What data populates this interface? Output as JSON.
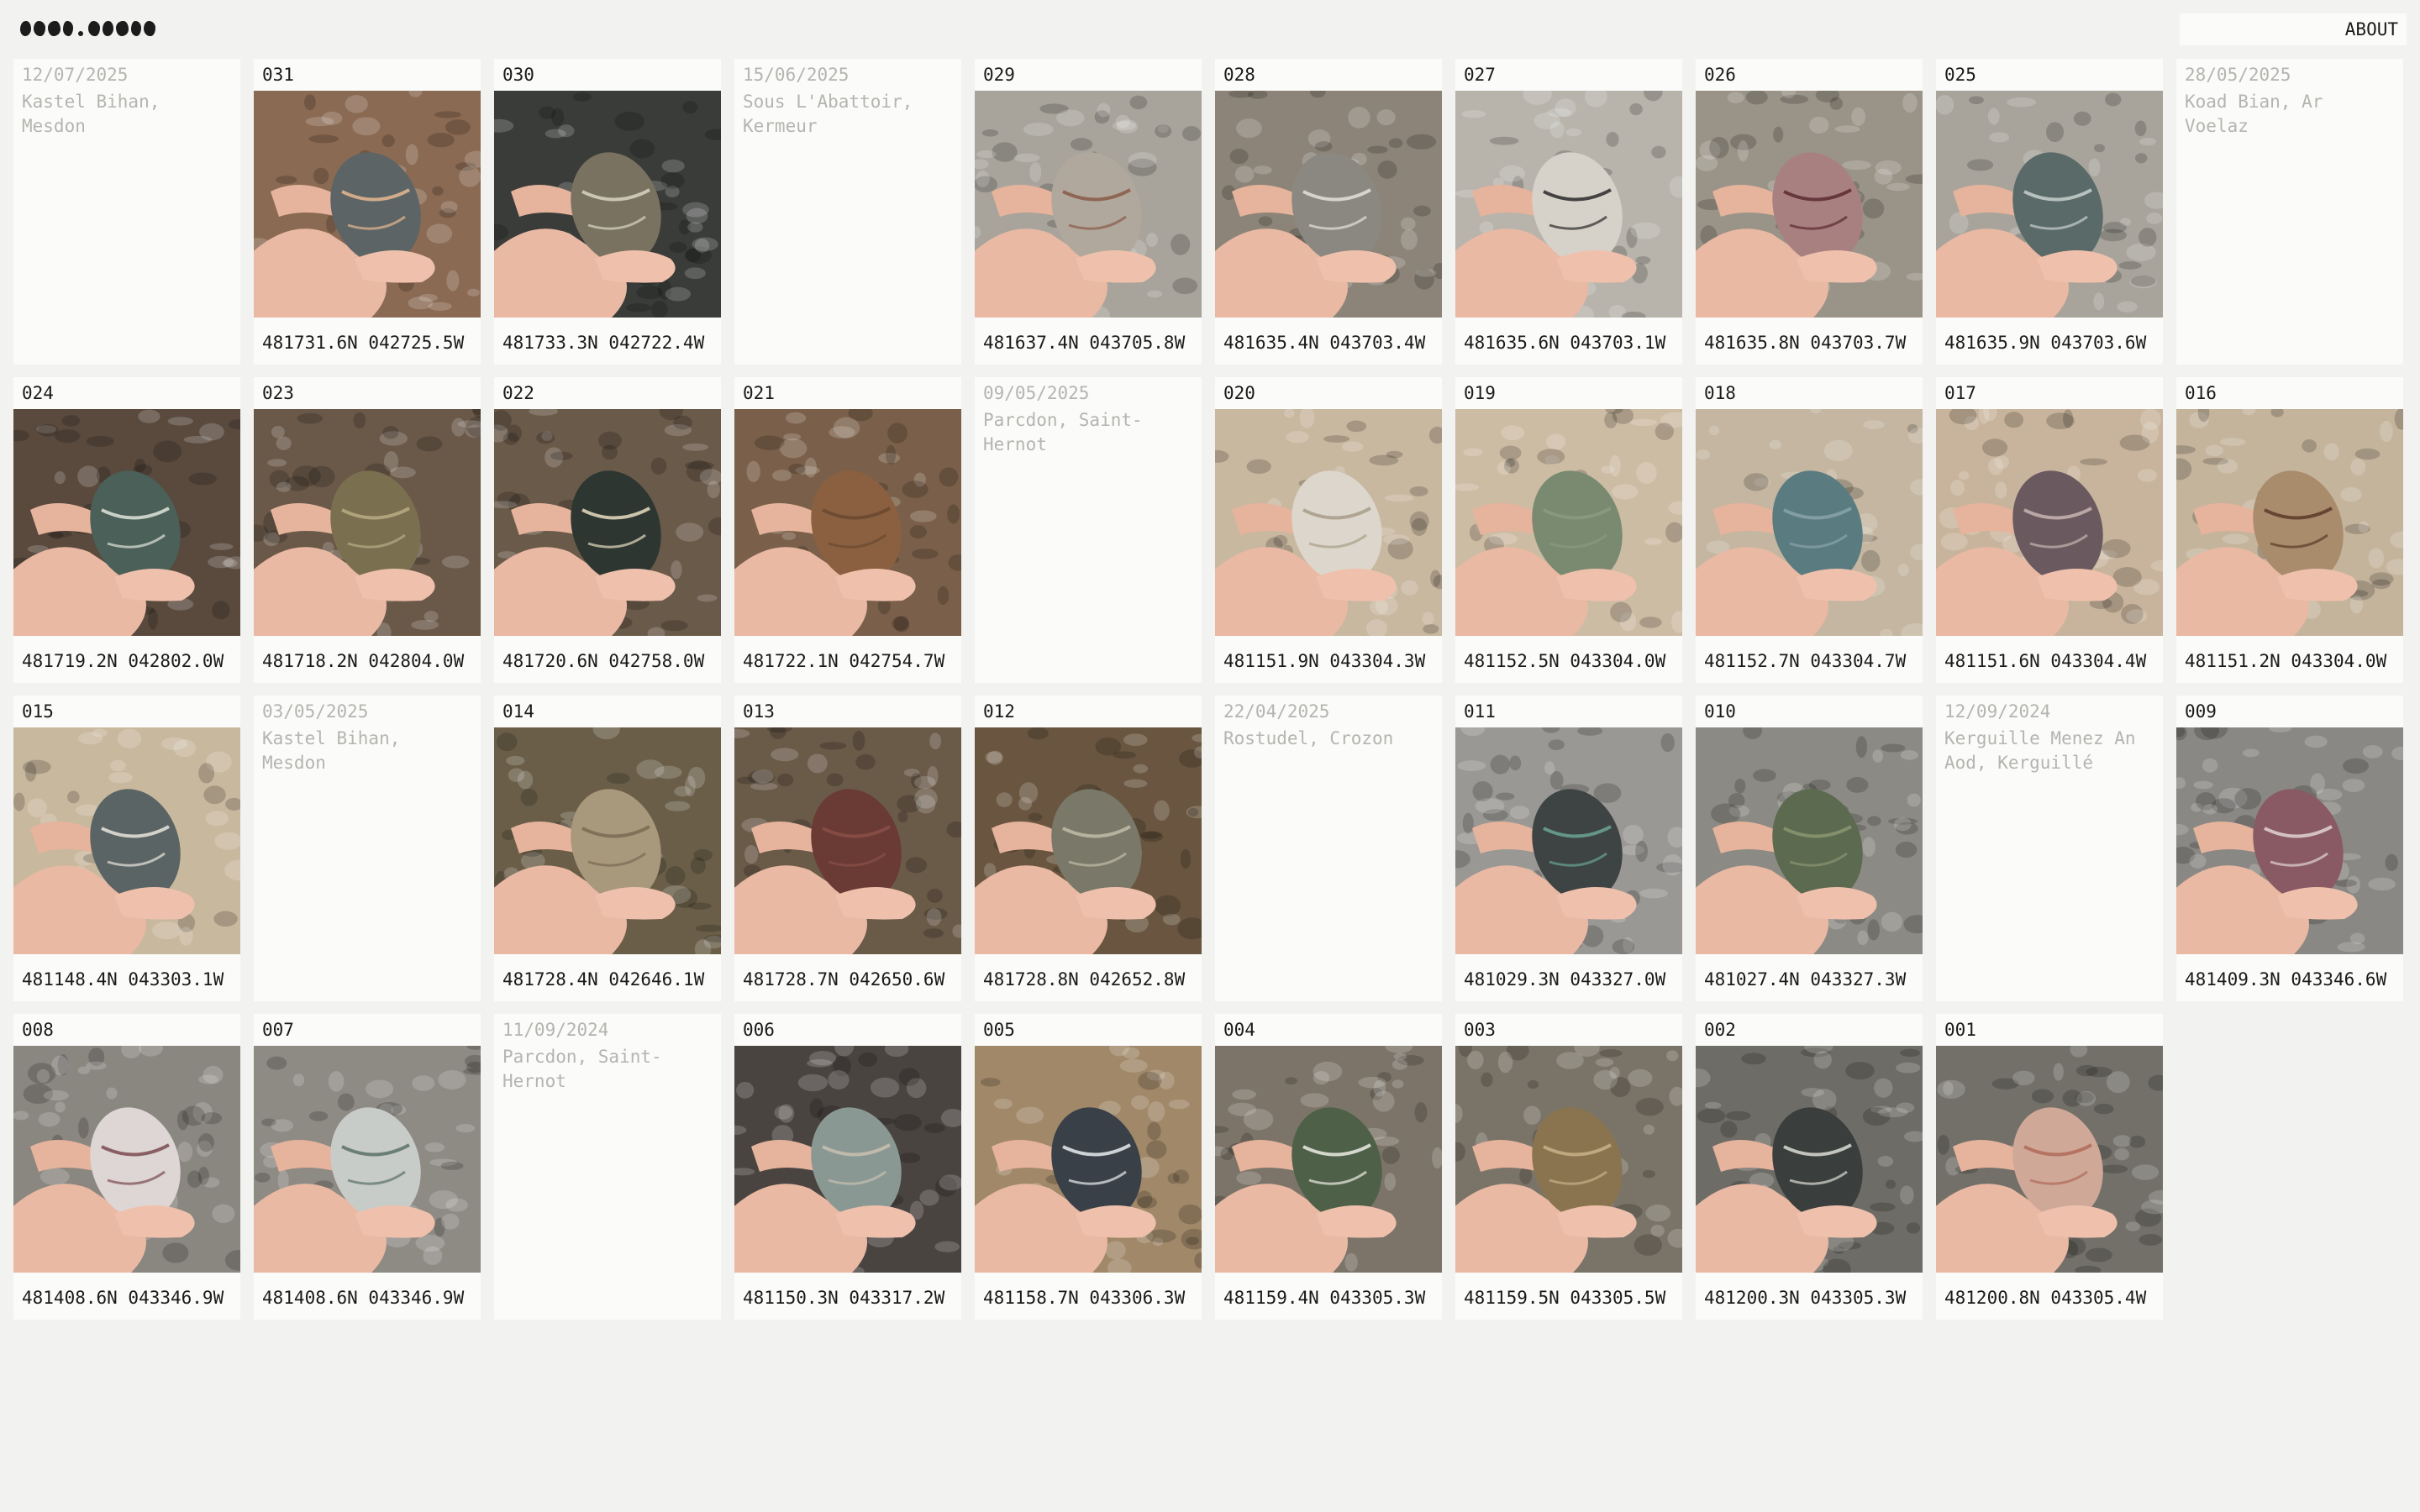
{
  "header": {
    "about_label": "ABOUT"
  },
  "cards": [
    {
      "kind": "date",
      "date": "12/07/2025",
      "place": "Kastel Bihan, Mesdon"
    },
    {
      "kind": "stone",
      "num": "031",
      "coord": "481731.6N 042725.5W",
      "bg": "#8a6a52",
      "stone": "#5c6466",
      "accent": "#e6b890"
    },
    {
      "kind": "stone",
      "num": "030",
      "coord": "481733.3N 042722.4W",
      "bg": "#3a3c3a",
      "stone": "#7a7260",
      "accent": "#d8d4c4"
    },
    {
      "kind": "date",
      "date": "15/06/2025",
      "place": "Sous L'Abattoir, Kermeur"
    },
    {
      "kind": "stone",
      "num": "029",
      "coord": "481637.4N 043705.8W",
      "bg": "#a8a49c",
      "stone": "#b0a89c",
      "accent": "#8a5a48"
    },
    {
      "kind": "stone",
      "num": "028",
      "coord": "481635.4N 043703.4W",
      "bg": "#8c8478",
      "stone": "#8a8880",
      "accent": "#e4e2dc"
    },
    {
      "kind": "stone",
      "num": "027",
      "coord": "481635.6N 043703.1W",
      "bg": "#b8b4ac",
      "stone": "#d6d2ca",
      "accent": "#2a2a2a"
    },
    {
      "kind": "stone",
      "num": "026",
      "coord": "481635.8N 043703.7W",
      "bg": "#9a9488",
      "stone": "#a88080",
      "accent": "#5a2a30"
    },
    {
      "kind": "stone",
      "num": "025",
      "coord": "481635.9N 043703.6W",
      "bg": "#a8a49c",
      "stone": "#5a6a68",
      "accent": "#c8d0cc"
    },
    {
      "kind": "date",
      "date": "28/05/2025",
      "place": "Koad Bian, Ar Voelaz"
    },
    {
      "kind": "stone",
      "num": "024",
      "coord": "481719.2N 042802.0W",
      "bg": "#5a4a3e",
      "stone": "#4a6058",
      "accent": "#e0e4dc"
    },
    {
      "kind": "stone",
      "num": "023",
      "coord": "481718.2N 042804.0W",
      "bg": "#6a5848",
      "stone": "#7a7050",
      "accent": "#b8ac84"
    },
    {
      "kind": "stone",
      "num": "022",
      "coord": "481720.6N 042758.0W",
      "bg": "#6a5a4a",
      "stone": "#2e3632",
      "accent": "#e6dcc0"
    },
    {
      "kind": "stone",
      "num": "021",
      "coord": "481722.1N 042754.7W",
      "bg": "#7a604a",
      "stone": "#8a6040",
      "accent": "#6a4830"
    },
    {
      "kind": "date",
      "date": "09/05/2025",
      "place": "Parcdon, Saint-Hernot"
    },
    {
      "kind": "stone",
      "num": "020",
      "coord": "481151.9N 043304.3W",
      "bg": "#c8b8a0",
      "stone": "#dcd6cc",
      "accent": "#a89c88"
    },
    {
      "kind": "stone",
      "num": "019",
      "coord": "481152.5N 043304.0W",
      "bg": "#cdbca4",
      "stone": "#7a8a70",
      "accent": "#8a9a80"
    },
    {
      "kind": "stone",
      "num": "018",
      "coord": "481152.7N 043304.7W",
      "bg": "#c4b6a0",
      "stone": "#5a7c80",
      "accent": "#8aa4a8"
    },
    {
      "kind": "stone",
      "num": "017",
      "coord": "481151.6N 043304.4W",
      "bg": "#c8b49c",
      "stone": "#6a5a60",
      "accent": "#c8b4b0"
    },
    {
      "kind": "stone",
      "num": "016",
      "coord": "481151.2N 043304.0W",
      "bg": "#c4b49c",
      "stone": "#a88c6c",
      "accent": "#5a3a28"
    },
    {
      "kind": "stone",
      "num": "015",
      "coord": "481148.4N 043303.1W",
      "bg": "#c8b89e",
      "stone": "#5a6464",
      "accent": "#e8e4dc"
    },
    {
      "kind": "date",
      "date": "03/05/2025",
      "place": "Kastel Bihan, Mesdon"
    },
    {
      "kind": "stone",
      "num": "014",
      "coord": "481728.4N 042646.1W",
      "bg": "#6a5e48",
      "stone": "#a8987c",
      "accent": "#7a6a54"
    },
    {
      "kind": "stone",
      "num": "013",
      "coord": "481728.7N 042650.6W",
      "bg": "#6a5a48",
      "stone": "#6a3a34",
      "accent": "#8a5048"
    },
    {
      "kind": "stone",
      "num": "012",
      "coord": "481728.8N 042652.8W",
      "bg": "#6a5640",
      "stone": "#7a7868",
      "accent": "#c0bca8"
    },
    {
      "kind": "date",
      "date": "22/04/2025",
      "place": "Rostudel, Crozon"
    },
    {
      "kind": "stone",
      "num": "011",
      "coord": "481029.3N 043327.0W",
      "bg": "#9a9894",
      "stone": "#3e4444",
      "accent": "#6aa490"
    },
    {
      "kind": "stone",
      "num": "010",
      "coord": "481027.4N 043327.3W",
      "bg": "#8c8a84",
      "stone": "#5c6a50",
      "accent": "#8a9670"
    },
    {
      "kind": "date",
      "date": "12/09/2024",
      "place": "Kerguille Menez An Aod, Kerguillé"
    },
    {
      "kind": "stone",
      "num": "009",
      "coord": "481409.3N 043346.6W",
      "bg": "#8a8884",
      "stone": "#8a5a64",
      "accent": "#e0d4d4"
    },
    {
      "kind": "stone",
      "num": "008",
      "coord": "481408.6N 043346.9W",
      "bg": "#8a8680",
      "stone": "#ddd6d4",
      "accent": "#7a4a50"
    },
    {
      "kind": "stone",
      "num": "007",
      "coord": "481408.6N 043346.9W",
      "bg": "#8e8a84",
      "stone": "#c8ccc8",
      "accent": "#5a7068"
    },
    {
      "kind": "date",
      "date": "11/09/2024",
      "place": "Parcdon, Saint-Hernot"
    },
    {
      "kind": "stone",
      "num": "006",
      "coord": "481150.3N 043317.2W",
      "bg": "#4a4440",
      "stone": "#8a9894",
      "accent": "#c8c0b0"
    },
    {
      "kind": "stone",
      "num": "005",
      "coord": "481158.7N 043306.3W",
      "bg": "#a08868",
      "stone": "#3a4048",
      "accent": "#e8ecf0"
    },
    {
      "kind": "stone",
      "num": "004",
      "coord": "481159.4N 043305.3W",
      "bg": "#7c7468",
      "stone": "#4e6048",
      "accent": "#ecece4"
    },
    {
      "kind": "stone",
      "num": "003",
      "coord": "481159.5N 043305.5W",
      "bg": "#7a7468",
      "stone": "#8a7450",
      "accent": "#c8b088"
    },
    {
      "kind": "stone",
      "num": "002",
      "coord": "481200.3N 043305.3W",
      "bg": "#6e6c66",
      "stone": "#3a3e3c",
      "accent": "#dcdcd4"
    },
    {
      "kind": "stone",
      "num": "001",
      "coord": "481200.8N 043305.4W",
      "bg": "#727068",
      "stone": "#d0a898",
      "accent": "#b06a58"
    }
  ]
}
